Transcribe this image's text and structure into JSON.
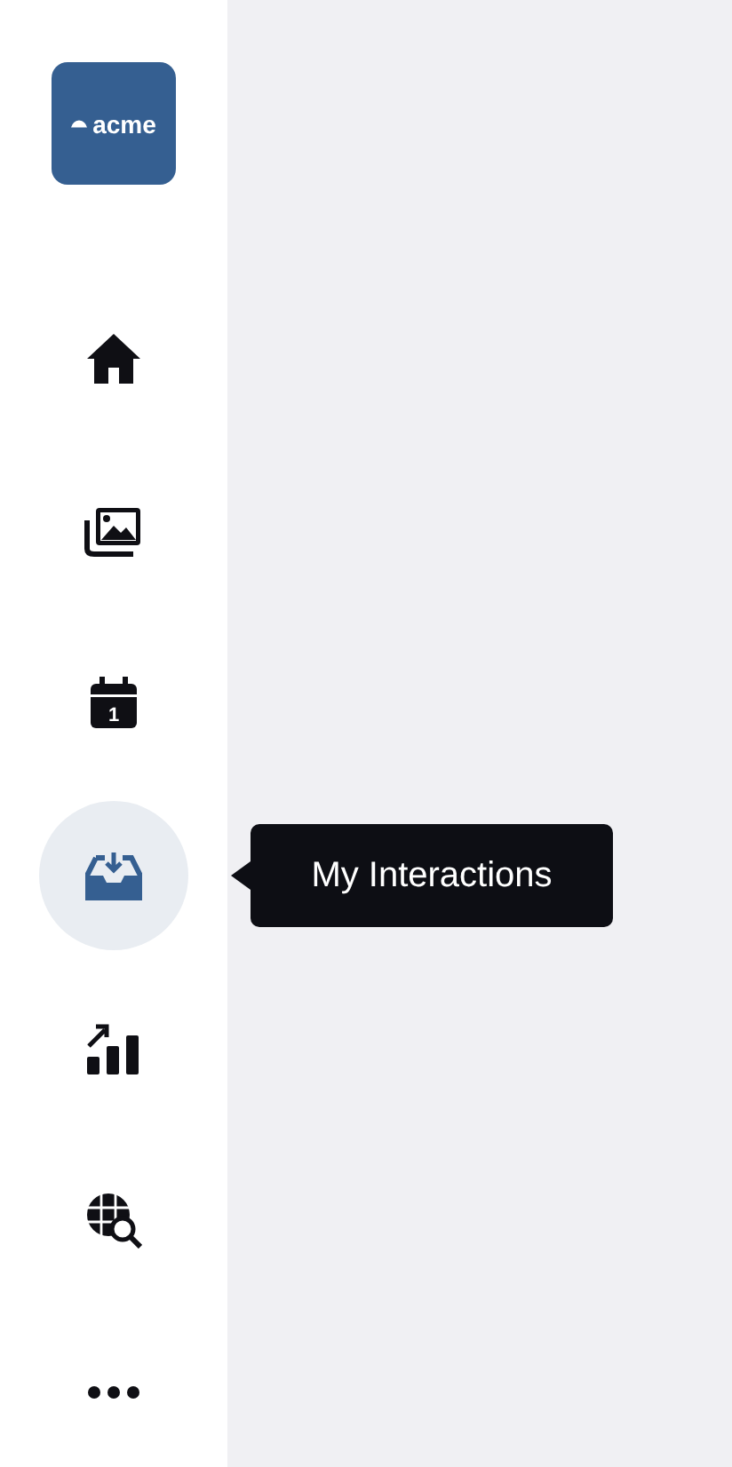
{
  "logo": {
    "text": "acme"
  },
  "nav": [
    {
      "kind": "home",
      "selected": false
    },
    {
      "kind": "gallery",
      "selected": false
    },
    {
      "kind": "calendar",
      "selected": false,
      "icon_text": "1"
    },
    {
      "kind": "inbox",
      "selected": true
    },
    {
      "kind": "analytics",
      "selected": false
    },
    {
      "kind": "globe-search",
      "selected": false
    },
    {
      "kind": "more",
      "selected": false
    }
  ],
  "tooltip": {
    "text": "My Interactions"
  }
}
